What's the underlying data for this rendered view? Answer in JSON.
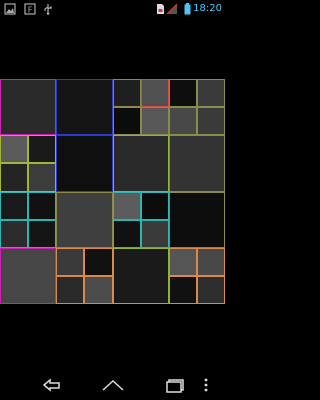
{
  "status_bar": {
    "time": "18:20",
    "left_icons": [
      "gallery-icon",
      "notification-icon",
      "usb-icon"
    ],
    "right_icons": [
      "sim-icon",
      "signal-icon",
      "battery-icon"
    ],
    "time_color": "#4fc3f7"
  },
  "grid": {
    "rows": 8,
    "cols": 8,
    "cells": [
      {
        "r": 0,
        "c": 0,
        "rs": 2,
        "cs": 2,
        "fill": "#2a2a2a",
        "stroke": "#d01fb6"
      },
      {
        "r": 0,
        "c": 2,
        "rs": 2,
        "cs": 2,
        "fill": "#141414",
        "stroke": "#2d39d6"
      },
      {
        "r": 0,
        "c": 4,
        "rs": 1,
        "cs": 1,
        "fill": "#1f1f1f",
        "stroke": "#8a8a4a"
      },
      {
        "r": 0,
        "c": 5,
        "rs": 1,
        "cs": 1,
        "fill": "#505050",
        "stroke": "#d84a3a"
      },
      {
        "r": 0,
        "c": 6,
        "rs": 1,
        "cs": 1,
        "fill": "#0e0e0e",
        "stroke": "#8a8a4a"
      },
      {
        "r": 0,
        "c": 7,
        "rs": 1,
        "cs": 1,
        "fill": "#3a3a3a",
        "stroke": "#8a8a4a"
      },
      {
        "r": 1,
        "c": 4,
        "rs": 1,
        "cs": 1,
        "fill": "#0c0c0c",
        "stroke": "#8a8a4a"
      },
      {
        "r": 1,
        "c": 5,
        "rs": 1,
        "cs": 1,
        "fill": "#585858",
        "stroke": "#8a8a4a"
      },
      {
        "r": 1,
        "c": 6,
        "rs": 1,
        "cs": 1,
        "fill": "#484848",
        "stroke": "#8a8a4a"
      },
      {
        "r": 1,
        "c": 7,
        "rs": 1,
        "cs": 1,
        "fill": "#3a3a3a",
        "stroke": "#8a8a4a"
      },
      {
        "r": 2,
        "c": 0,
        "rs": 1,
        "cs": 1,
        "fill": "#5a5a5a",
        "stroke": "#a3b534"
      },
      {
        "r": 2,
        "c": 1,
        "rs": 1,
        "cs": 1,
        "fill": "#1a1a1a",
        "stroke": "#a3b534"
      },
      {
        "r": 2,
        "c": 2,
        "rs": 2,
        "cs": 2,
        "fill": "#0f0f0f",
        "stroke": "#2d39d6"
      },
      {
        "r": 2,
        "c": 4,
        "rs": 2,
        "cs": 2,
        "fill": "#2a2a2a",
        "stroke": "#8fb534"
      },
      {
        "r": 2,
        "c": 6,
        "rs": 2,
        "cs": 2,
        "fill": "#333333",
        "stroke": "#8a8a4a"
      },
      {
        "r": 3,
        "c": 0,
        "rs": 1,
        "cs": 1,
        "fill": "#242424",
        "stroke": "#a3b534"
      },
      {
        "r": 3,
        "c": 1,
        "rs": 1,
        "cs": 1,
        "fill": "#3c3c3c",
        "stroke": "#a3b534"
      },
      {
        "r": 4,
        "c": 0,
        "rs": 1,
        "cs": 1,
        "fill": "#1a1a1a",
        "stroke": "#2bb5b5"
      },
      {
        "r": 4,
        "c": 1,
        "rs": 1,
        "cs": 1,
        "fill": "#111111",
        "stroke": "#2bb5b5"
      },
      {
        "r": 4,
        "c": 2,
        "rs": 2,
        "cs": 2,
        "fill": "#3f3f3f",
        "stroke": "#8a8a4a"
      },
      {
        "r": 4,
        "c": 4,
        "rs": 1,
        "cs": 1,
        "fill": "#5c5c5c",
        "stroke": "#2bb5b5"
      },
      {
        "r": 4,
        "c": 5,
        "rs": 1,
        "cs": 1,
        "fill": "#0c0c0c",
        "stroke": "#2bb5b5"
      },
      {
        "r": 4,
        "c": 6,
        "rs": 2,
        "cs": 2,
        "fill": "#0d0d0d",
        "stroke": "#8a8a4a"
      },
      {
        "r": 5,
        "c": 0,
        "rs": 1,
        "cs": 1,
        "fill": "#2c2c2c",
        "stroke": "#2bb5b5"
      },
      {
        "r": 5,
        "c": 1,
        "rs": 1,
        "cs": 1,
        "fill": "#151515",
        "stroke": "#2bb5b5"
      },
      {
        "r": 5,
        "c": 4,
        "rs": 1,
        "cs": 1,
        "fill": "#111111",
        "stroke": "#2bb5b5"
      },
      {
        "r": 5,
        "c": 5,
        "rs": 1,
        "cs": 1,
        "fill": "#3a3a3a",
        "stroke": "#2bb5b5"
      },
      {
        "r": 6,
        "c": 0,
        "rs": 2,
        "cs": 2,
        "fill": "#464646",
        "stroke": "#d01fb6"
      },
      {
        "r": 6,
        "c": 2,
        "rs": 1,
        "cs": 1,
        "fill": "#3a3a3a",
        "stroke": "#d88a4a"
      },
      {
        "r": 6,
        "c": 3,
        "rs": 1,
        "cs": 1,
        "fill": "#111111",
        "stroke": "#d88a4a"
      },
      {
        "r": 6,
        "c": 4,
        "rs": 2,
        "cs": 2,
        "fill": "#1a1a1a",
        "stroke": "#8fb534"
      },
      {
        "r": 6,
        "c": 6,
        "rs": 1,
        "cs": 1,
        "fill": "#555555",
        "stroke": "#d88a4a"
      },
      {
        "r": 6,
        "c": 7,
        "rs": 1,
        "cs": 1,
        "fill": "#484848",
        "stroke": "#d88a4a"
      },
      {
        "r": 7,
        "c": 2,
        "rs": 1,
        "cs": 1,
        "fill": "#2a2a2a",
        "stroke": "#d88a4a"
      },
      {
        "r": 7,
        "c": 3,
        "rs": 1,
        "cs": 1,
        "fill": "#4c4c4c",
        "stroke": "#d88a4a"
      },
      {
        "r": 7,
        "c": 6,
        "rs": 1,
        "cs": 1,
        "fill": "#111111",
        "stroke": "#d88a4a"
      },
      {
        "r": 7,
        "c": 7,
        "rs": 1,
        "cs": 1,
        "fill": "#2e2e2e",
        "stroke": "#d88a4a"
      }
    ]
  },
  "nav_bar": {
    "buttons": [
      "back-icon",
      "home-icon",
      "recents-icon",
      "menu-icon"
    ]
  }
}
